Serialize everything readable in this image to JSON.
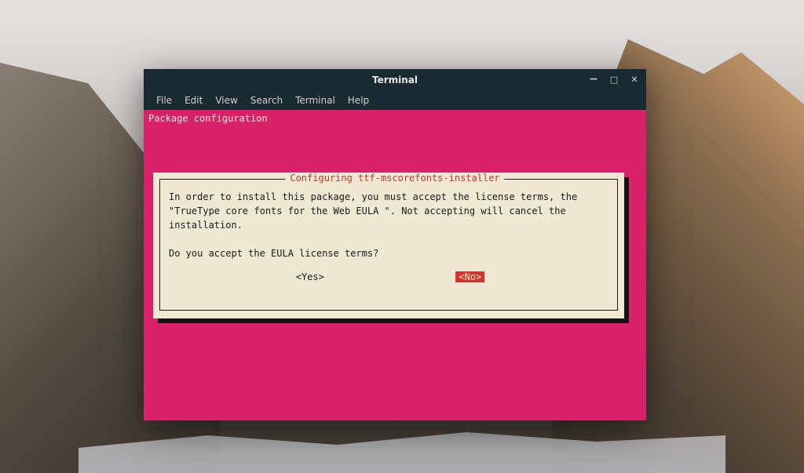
{
  "window": {
    "title": "Terminal"
  },
  "menubar": {
    "items": [
      "File",
      "Edit",
      "View",
      "Search",
      "Terminal",
      "Help"
    ]
  },
  "terminal": {
    "header": "Package configuration"
  },
  "dialog": {
    "title": " Configuring ttf-mscorefonts-installer ",
    "body_line1": "In order to install this package, you must accept the license terms, the",
    "body_line2": "\"TrueType core fonts for the Web EULA \". Not accepting will cancel the",
    "body_line3": "installation.",
    "question": "Do you accept the EULA license terms?",
    "yes_label": "<Yes>",
    "no_label": "<No>"
  }
}
